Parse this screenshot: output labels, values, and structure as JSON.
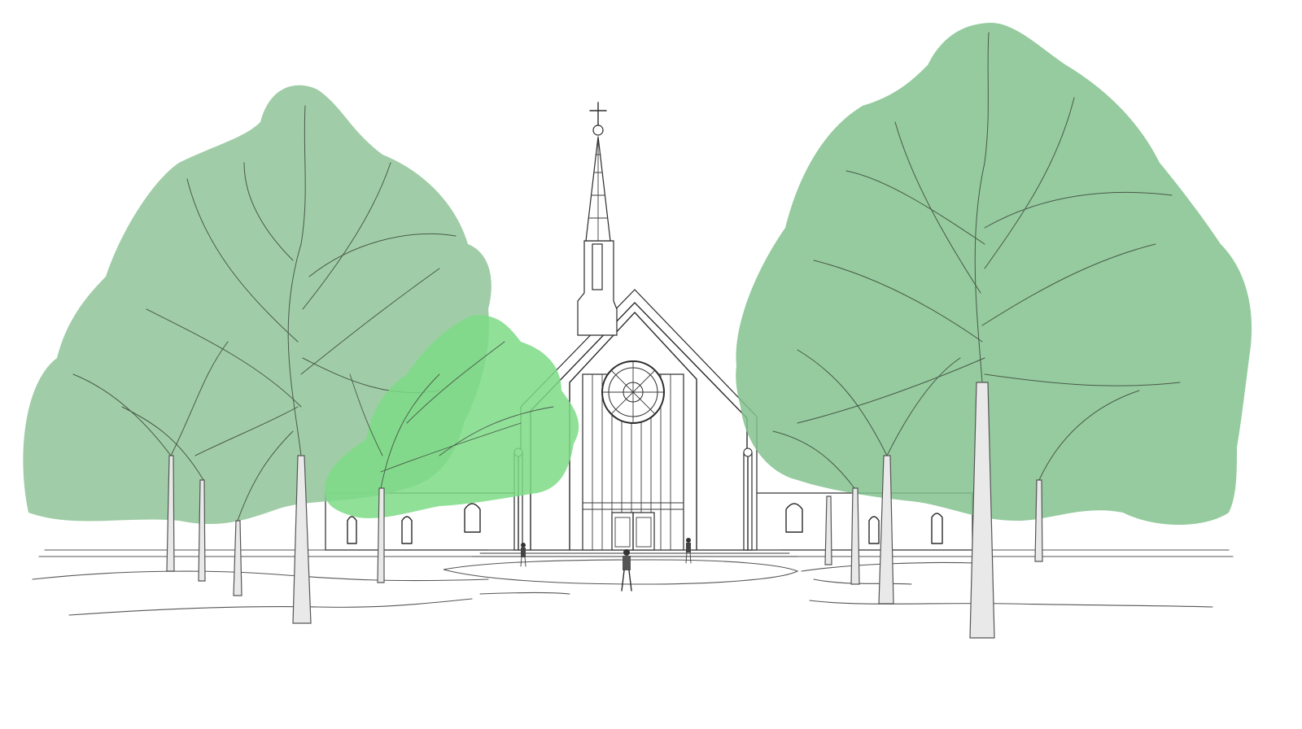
{
  "scene": {
    "kind": "architectural sketch",
    "colors": {
      "canopy_left": "#8fc498",
      "canopy_center": "#7ddb86",
      "canopy_right": "#82c28d",
      "ink": "#2b2b2b",
      "background": "#ffffff"
    },
    "elements": {
      "left_tree": "large-tree-left",
      "center_tree": "small-tree-center",
      "right_tree": "large-tree-right",
      "building": "church",
      "people_count": 3
    }
  }
}
